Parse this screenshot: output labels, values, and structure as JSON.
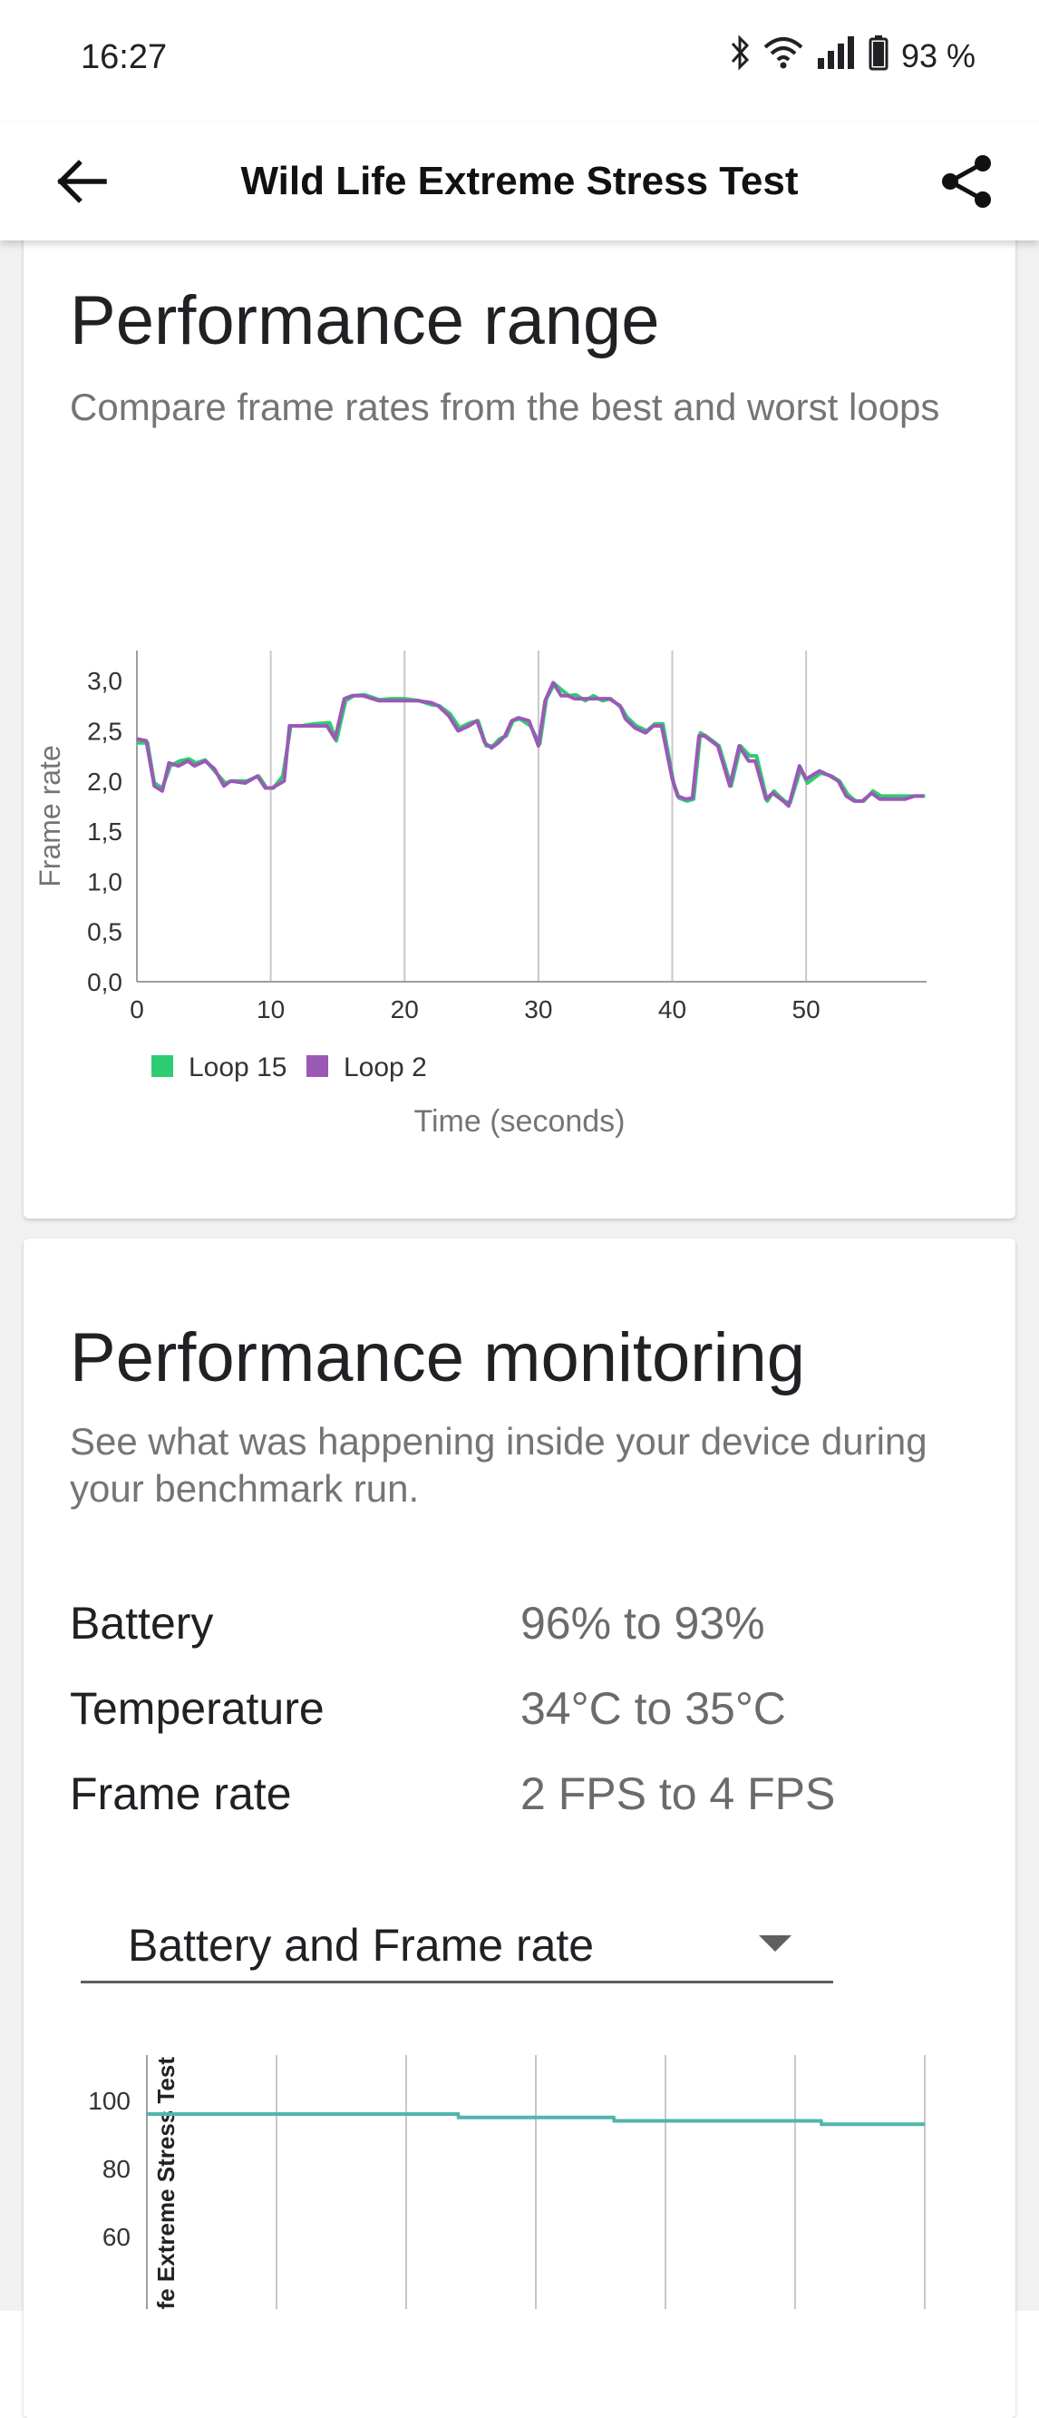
{
  "status_bar": {
    "time": "16:27",
    "battery_pct": "93 %"
  },
  "app_bar": {
    "title": "Wild Life Extreme Stress Test",
    "back_icon": "arrow-left-icon",
    "share_icon": "share-icon"
  },
  "range_card": {
    "title": "Performance range",
    "subtitle": "Compare frame rates from the best and worst loops"
  },
  "chart_data": [
    {
      "type": "line",
      "ylabel": "Frame rate",
      "xlabel": "Time (seconds)",
      "xlim": [
        0,
        59
      ],
      "ylim": [
        0,
        3.3
      ],
      "x_ticks": [
        0,
        10,
        20,
        30,
        40,
        50
      ],
      "y_ticks": [
        "0,0",
        "0,5",
        "1,0",
        "1,5",
        "2,0",
        "2,5",
        "3,0"
      ],
      "grid": "vertical",
      "legend": "bottom-left",
      "colors": {
        "Loop 15": "#2ecc71",
        "Loop 2": "#9b59b6"
      },
      "series": [
        {
          "name": "Loop 15",
          "x": [
            0,
            0.8,
            1.3,
            1.9,
            2.5,
            3.2,
            3.9,
            4.4,
            5.1,
            5.8,
            6.6,
            7.1,
            8.2,
            9.1,
            9.7,
            10.2,
            10.9,
            11.5,
            12.3,
            13.3,
            14.4,
            14.9,
            15.6,
            16.2,
            17,
            18.1,
            19,
            20,
            21.1,
            22,
            22.6,
            23.4,
            24.1,
            24.9,
            25.5,
            26.1,
            26.6,
            27.1,
            27.6,
            28.1,
            28.6,
            29.4,
            30.1,
            30.6,
            31.2,
            31.8,
            32.3,
            32.8,
            33.5,
            34.1,
            34.8,
            35.4,
            36.2,
            36.6,
            37.3,
            38.1,
            38.7,
            39.3,
            40.1,
            40.5,
            41.1,
            41.6,
            42.1,
            42.5,
            43,
            43.5,
            44.4,
            45.1,
            45.8,
            46.3,
            47.1,
            47.6,
            47.9,
            48.4,
            48.8,
            49.6,
            50.1,
            51.1,
            51.9,
            52.5,
            53.1,
            53.7,
            54.3,
            55,
            55.6,
            56.1,
            56.9,
            57.5,
            58.2,
            58.9
          ],
          "y": [
            2.38,
            2.38,
            1.98,
            1.93,
            2.15,
            2.2,
            2.22,
            2.18,
            2.21,
            2.1,
            1.98,
            2.0,
            2.0,
            2.05,
            1.93,
            1.93,
            2.05,
            2.55,
            2.55,
            2.57,
            2.58,
            2.4,
            2.8,
            2.85,
            2.86,
            2.81,
            2.82,
            2.82,
            2.8,
            2.76,
            2.75,
            2.67,
            2.53,
            2.58,
            2.6,
            2.35,
            2.35,
            2.42,
            2.45,
            2.6,
            2.62,
            2.55,
            2.37,
            2.82,
            2.97,
            2.9,
            2.85,
            2.86,
            2.8,
            2.85,
            2.8,
            2.82,
            2.73,
            2.64,
            2.55,
            2.5,
            2.57,
            2.57,
            1.98,
            1.83,
            1.8,
            1.82,
            2.48,
            2.45,
            2.4,
            2.35,
            1.95,
            2.35,
            2.25,
            2.25,
            1.8,
            1.9,
            1.86,
            1.8,
            1.78,
            2.12,
            1.98,
            2.08,
            2.05,
            2.0,
            1.87,
            1.8,
            1.8,
            1.9,
            1.85,
            1.85,
            1.85,
            1.85,
            1.85,
            1.85
          ]
        },
        {
          "name": "Loop 2",
          "x": [
            0,
            0.7,
            1.3,
            1.9,
            2.4,
            3.1,
            3.8,
            4.3,
            5.1,
            5.8,
            6.5,
            7,
            8.1,
            9,
            9.6,
            10.1,
            11,
            11.4,
            12.2,
            13.2,
            14.2,
            14.8,
            15.5,
            16.1,
            16.9,
            18.1,
            19,
            20,
            21,
            22,
            22.5,
            23.3,
            24,
            24.8,
            25.4,
            26,
            26.5,
            27,
            27.5,
            28,
            28.5,
            29.3,
            30,
            30.5,
            31.1,
            31.7,
            32.2,
            32.7,
            33.4,
            34,
            34.7,
            35.3,
            36.1,
            36.5,
            37.2,
            38,
            38.6,
            39.2,
            40,
            40.4,
            41,
            41.5,
            42,
            42.4,
            42.9,
            43.4,
            44.3,
            45,
            45.7,
            46.2,
            47,
            47.5,
            47.8,
            48.3,
            48.7,
            49.5,
            50,
            51,
            51.8,
            52.4,
            53,
            53.6,
            54.2,
            54.9,
            55.5,
            56,
            56.8,
            57.4,
            58.1,
            58.8
          ],
          "y": [
            2.42,
            2.4,
            1.95,
            1.9,
            2.18,
            2.15,
            2.2,
            2.15,
            2.2,
            2.12,
            1.95,
            2.0,
            1.98,
            2.05,
            1.93,
            1.93,
            2.0,
            2.55,
            2.55,
            2.55,
            2.55,
            2.42,
            2.82,
            2.85,
            2.85,
            2.8,
            2.8,
            2.8,
            2.8,
            2.78,
            2.75,
            2.65,
            2.5,
            2.55,
            2.6,
            2.38,
            2.33,
            2.38,
            2.45,
            2.6,
            2.63,
            2.6,
            2.35,
            2.8,
            2.98,
            2.85,
            2.85,
            2.82,
            2.82,
            2.82,
            2.82,
            2.82,
            2.75,
            2.62,
            2.53,
            2.48,
            2.55,
            2.55,
            2.02,
            1.85,
            1.82,
            1.83,
            2.45,
            2.45,
            2.4,
            2.35,
            1.95,
            2.35,
            2.2,
            2.2,
            1.82,
            1.88,
            1.85,
            1.8,
            1.75,
            2.15,
            2.02,
            2.1,
            2.05,
            2.0,
            1.85,
            1.8,
            1.8,
            1.88,
            1.82,
            1.82,
            1.82,
            1.82,
            1.85,
            1.85
          ]
        }
      ]
    },
    {
      "type": "line",
      "ylabel": "Wild Life Extreme Stress Test",
      "y_ticks": [
        "100",
        "80",
        "60"
      ],
      "ylim": [
        50,
        100
      ],
      "grid": "vertical",
      "colors": {
        "Battery": "#4fb6ad"
      },
      "series": [
        {
          "x": [
            0,
            1,
            2,
            3,
            4,
            5,
            6,
            6.01,
            7,
            8,
            9,
            9.01,
            10,
            11,
            12,
            13,
            13.01,
            14,
            15
          ],
          "y": [
            96,
            96,
            96,
            96,
            96,
            96,
            96,
            95,
            95,
            95,
            95,
            94,
            94,
            94,
            94,
            94,
            93,
            93,
            93
          ]
        }
      ]
    }
  ],
  "monitor_card": {
    "title": "Performance monitoring",
    "subtitle": "See what was happening inside your device during your benchmark run.",
    "stats": [
      {
        "label": "Battery",
        "value": "96% to 93%"
      },
      {
        "label": "Temperature",
        "value": "34°C to 35°C"
      },
      {
        "label": "Frame rate",
        "value": "2 FPS to 4 FPS"
      }
    ],
    "dropdown": {
      "selected": "Battery and Frame rate",
      "icon": "dropdown-arrow-icon"
    }
  }
}
